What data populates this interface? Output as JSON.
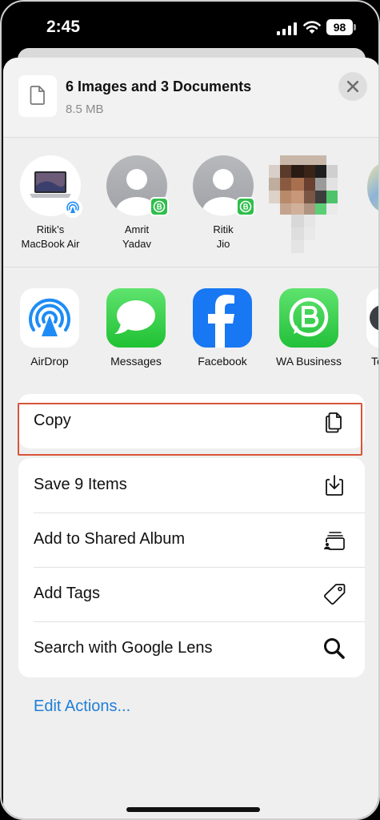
{
  "status_bar": {
    "time": "2:45",
    "battery": "98"
  },
  "header": {
    "title": "6 Images and 3 Documents",
    "size": "8.5 MB"
  },
  "people": [
    {
      "name_line1": "Ritik’s",
      "name_line2": "MacBook Air"
    },
    {
      "name_line1": "Amrit",
      "name_line2": "Yadav"
    },
    {
      "name_line1": "Ritik",
      "name_line2": "Jio"
    }
  ],
  "apps": [
    {
      "label": "AirDrop",
      "icon": "airdrop-icon"
    },
    {
      "label": "Messages",
      "icon": "messages-icon"
    },
    {
      "label": "Facebook",
      "icon": "facebook-icon"
    },
    {
      "label": "WA Business",
      "icon": "wa-business-icon"
    },
    {
      "label": "Te",
      "icon": "partial-app-icon"
    }
  ],
  "actions": {
    "copy": "Copy",
    "save": "Save 9 Items",
    "shared_album": "Add to Shared Album",
    "tags": "Add Tags",
    "google_lens": "Search with Google Lens"
  },
  "edit_actions": "Edit Actions...",
  "colors": {
    "accent": "#1f7fd6",
    "highlight": "#d9533a",
    "whatsapp": "#2fbe4b",
    "facebook": "#1877f2",
    "airdrop": "#1f8cf5"
  }
}
